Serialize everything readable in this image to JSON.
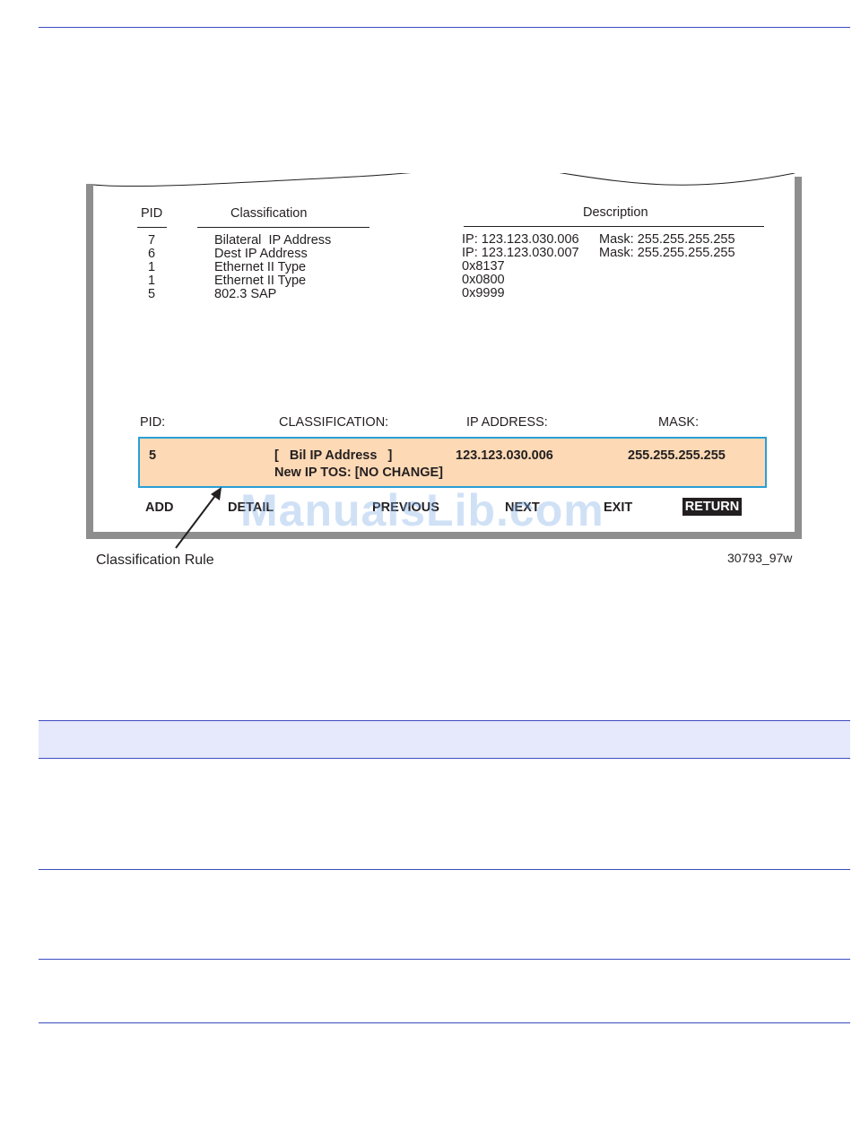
{
  "screen": {
    "list_headers": {
      "pid": "PID",
      "classification": "Classification",
      "description": "Description"
    },
    "rows": [
      {
        "pid": "7",
        "classification": "Bilateral  IP Address",
        "description": "IP: 123.123.030.006",
        "mask": "Mask: 255.255.255.255"
      },
      {
        "pid": "6",
        "classification": "Dest IP Address",
        "description": "IP: 123.123.030.007",
        "mask": "Mask: 255.255.255.255"
      },
      {
        "pid": "1",
        "classification": "Ethernet II Type",
        "description": "0x8137",
        "mask": ""
      },
      {
        "pid": "1",
        "classification": "Ethernet II Type",
        "description": "0x0800",
        "mask": ""
      },
      {
        "pid": "5",
        "classification": "802.3 SAP",
        "description": "0x9999",
        "mask": ""
      }
    ],
    "field_labels": {
      "pid": "PID:",
      "classification": "CLASSIFICATION:",
      "ip_address": "IP ADDRESS:",
      "mask": "MASK:"
    },
    "selected": {
      "pid": "5",
      "classification": "[   Bil IP Address   ]",
      "ip_address": "123.123.030.006",
      "mask": "255.255.255.255",
      "tos": "New IP TOS: [NO CHANGE]"
    },
    "commands": [
      "ADD",
      "DETAIL",
      "PREVIOUS",
      "NEXT",
      "EXIT",
      "RETURN"
    ]
  },
  "callout": "Classification Rule",
  "figure_id": "30793_97w",
  "watermark": "ManualsLib.com",
  "colors": {
    "rule_line": "#3b4cc0",
    "selected_fill": "#fdd9b5",
    "selected_border": "#2a9fd6",
    "header_band": "#e6e8fb"
  }
}
